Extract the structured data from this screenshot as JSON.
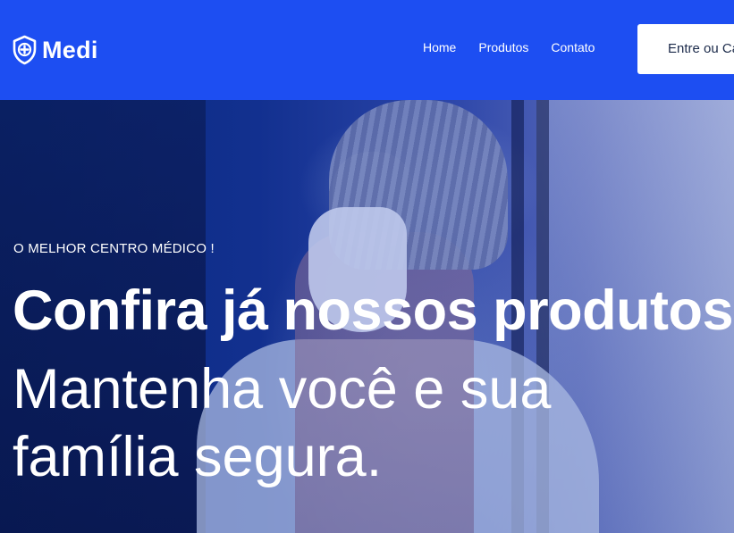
{
  "brand": {
    "name": "Medi",
    "icon": "shield-plus-icon",
    "color": "#1d4ef2"
  },
  "nav": {
    "items": [
      "Home",
      "Produtos",
      "Contato"
    ]
  },
  "cta": {
    "label": "Entre ou Ca"
  },
  "hero": {
    "eyebrow": "O MELHOR CENTRO MÉDICO !",
    "headline": "Confira já nossos produtos!",
    "subhead": "Mantenha você e sua família segura."
  }
}
